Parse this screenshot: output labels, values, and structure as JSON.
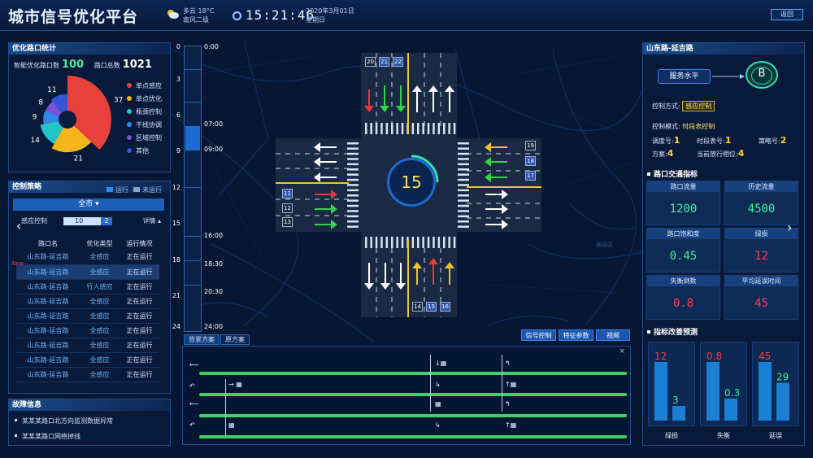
{
  "header": {
    "title": "城市信号优化平台",
    "weather_line1": "多云  18°C",
    "weather_line2": "南风二级",
    "time": "15:21:46",
    "date": "2020年3月01日",
    "weekday": "星期日",
    "back_label": "返回"
  },
  "stats": {
    "title": "优化路口统计",
    "smart_label": "智能优化路口数",
    "smart_value": "100",
    "total_label": "路口总数",
    "total_value": "1021",
    "donut_labels": [
      "11",
      "37",
      "8",
      "9",
      "14",
      "21"
    ],
    "legend": [
      {
        "label": "单点感应",
        "color": "#e8413c"
      },
      {
        "label": "单点优化",
        "color": "#f2b51c"
      },
      {
        "label": "瓶颈控制",
        "color": "#22c4c8"
      },
      {
        "label": "干线协调",
        "color": "#2e8ae6"
      },
      {
        "label": "区域控制",
        "color": "#7a52d8"
      },
      {
        "label": "其他",
        "color": "#3356d6"
      }
    ],
    "chart_data": {
      "type": "pie",
      "categories": [
        "单点感应",
        "单点优化",
        "瓶颈控制",
        "干线协调",
        "区域控制",
        "其他"
      ],
      "values": [
        37,
        21,
        14,
        9,
        8,
        11
      ]
    }
  },
  "strategy": {
    "title": "控制策略",
    "legend_running": "运行",
    "legend_idle": "未运行",
    "city_label": "全市 ▾",
    "filter_label": "感应控制",
    "filter_value": "10",
    "filter_value2": "2",
    "detail_label": "详情 ▴",
    "columns": [
      "路口名",
      "优化类型",
      "运行情况"
    ],
    "rows": [
      [
        "山东路-延吉路",
        "全感应",
        "正在运行"
      ],
      [
        "山东路-延吉路",
        "全感应",
        "正在运行"
      ],
      [
        "山东路-延吉路",
        "行人感应",
        "正在运行"
      ],
      [
        "山东路-延吉路",
        "全感应",
        "正在运行"
      ],
      [
        "山东路-延吉路",
        "全感应",
        "正在运行"
      ],
      [
        "山东路-延吉路",
        "全感应",
        "正在运行"
      ],
      [
        "山东路-延吉路",
        "全感应",
        "正在运行"
      ],
      [
        "山东路-延吉路",
        "全感应",
        "正在运行"
      ],
      [
        "山东路-延吉路",
        "全感应",
        "正在运行"
      ]
    ],
    "new_tag": "New"
  },
  "faults": {
    "title": "故障信息",
    "items": [
      "某某某路口北方向监测数据异常",
      "某某某路口网络掉线"
    ]
  },
  "timeline": {
    "numbers": [
      "0",
      "3",
      "6",
      "9",
      "12",
      "15",
      "18",
      "21",
      "24"
    ],
    "times": [
      "0:00",
      "07:00",
      "09:00",
      "16:00",
      "18:30",
      "20:30",
      "24:00"
    ]
  },
  "intersection": {
    "countdown": "15",
    "lane_numbers": [
      "20",
      "21",
      "22",
      "19",
      "18",
      "17",
      "11",
      "12",
      "13",
      "14",
      "15",
      "16"
    ],
    "district": "嵩县区"
  },
  "phase": {
    "tab_bg": "背景方案",
    "tab_orig": "原方案",
    "btn_signal": "信号控制",
    "btn_feature": "特征参数",
    "btn_video": "视频",
    "close": "×"
  },
  "right": {
    "title": "山东路-延吉路",
    "service_label": "服务水平",
    "level": "B",
    "ctrl_mode_label": "控制方式:",
    "ctrl_mode_value": "感应控制",
    "ctrl_pattern_label": "控制模式:",
    "ctrl_pattern_value": "时段表控制",
    "sched_label": "调度号:",
    "sched_value": "1",
    "period_label": "时段表号:",
    "period_value": "1",
    "policy_label": "策略号:",
    "policy_value": "2",
    "plan_label": "方案:",
    "plan_value": "4",
    "phase_label": "当前放行相位:",
    "phase_value": "4",
    "metrics_title": "路口交通指标",
    "metrics": [
      {
        "label": "路口流量",
        "value": "1200"
      },
      {
        "label": "历史流量",
        "value": "4500"
      },
      {
        "label": "路口饱和度",
        "value": "0.45"
      },
      {
        "label": "绿损",
        "value": "12"
      },
      {
        "label": "失衡倒数",
        "value": "0.8"
      },
      {
        "label": "平均延误时间",
        "value": "45"
      }
    ],
    "forecast_title": "指标改善预测",
    "forecast_chart": {
      "type": "bar",
      "categories": [
        "绿损",
        "失衡",
        "延误"
      ],
      "series": [
        {
          "values": [
            12,
            0.8,
            45
          ]
        },
        {
          "values": [
            3,
            0.3,
            29
          ]
        }
      ]
    },
    "forecast_labels": {
      "a": [
        "12",
        "3"
      ],
      "b": [
        "0.8",
        "0.3"
      ],
      "c": [
        "45",
        "29"
      ]
    }
  }
}
